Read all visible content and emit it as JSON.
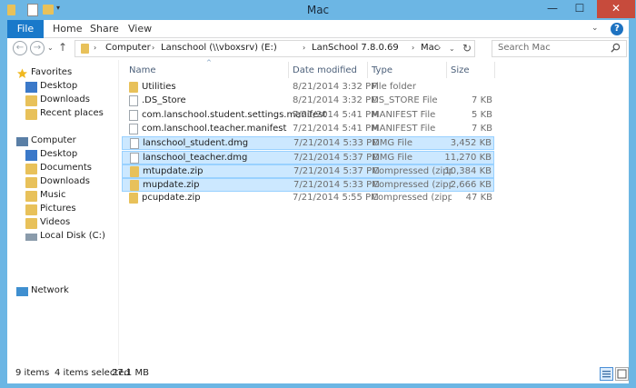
{
  "window": {
    "title": "Mac",
    "minimize": "—",
    "maximize": "☐",
    "close": "✕"
  },
  "ribbon": {
    "tabs": [
      "File",
      "Home",
      "Share",
      "View"
    ],
    "help": "?"
  },
  "nav": {
    "back": "←",
    "forward": "→",
    "recent": "⌄",
    "up": "↑",
    "breadcrumb": [
      "Computer",
      "Lanschool (\\\\vboxsrv) (E:)",
      "LanSchool 7.8.0.69",
      "Mac"
    ],
    "search_placeholder": "Search Mac"
  },
  "sidebar": {
    "favorites": {
      "label": "Favorites",
      "items": [
        "Desktop",
        "Downloads",
        "Recent places"
      ]
    },
    "computer": {
      "label": "Computer",
      "items": [
        "Desktop",
        "Documents",
        "Downloads",
        "Music",
        "Pictures",
        "Videos",
        "Local Disk (C:)"
      ]
    },
    "network": {
      "label": "Network"
    }
  },
  "columns": {
    "name": "Name",
    "date": "Date modified",
    "type": "Type",
    "size": "Size"
  },
  "files": [
    {
      "name": "Utilities",
      "date": "8/21/2014 3:32 PM",
      "type": "File folder",
      "size": "",
      "icon": "folder-icon",
      "selected": false
    },
    {
      "name": ".DS_Store",
      "date": "8/21/2014 3:32 PM",
      "type": "DS_STORE File",
      "size": "7 KB",
      "icon": "file-icon",
      "selected": false
    },
    {
      "name": "com.lanschool.student.settings.manifest",
      "date": "7/21/2014 5:41 PM",
      "type": "MANIFEST File",
      "size": "5 KB",
      "icon": "file-icon",
      "selected": false
    },
    {
      "name": "com.lanschool.teacher.manifest",
      "date": "7/21/2014 5:41 PM",
      "type": "MANIFEST File",
      "size": "7 KB",
      "icon": "file-icon",
      "selected": false
    },
    {
      "name": "lanschool_student.dmg",
      "date": "7/21/2014 5:33 PM",
      "type": "DMG File",
      "size": "3,452 KB",
      "icon": "file-icon",
      "selected": true
    },
    {
      "name": "lanschool_teacher.dmg",
      "date": "7/21/2014 5:37 PM",
      "type": "DMG File",
      "size": "11,270 KB",
      "icon": "file-icon",
      "selected": true
    },
    {
      "name": "mtupdate.zip",
      "date": "7/21/2014 5:37 PM",
      "type": "Compressed (zipp...",
      "size": "10,384 KB",
      "icon": "zip-folder-icon",
      "selected": true
    },
    {
      "name": "mupdate.zip",
      "date": "7/21/2014 5:33 PM",
      "type": "Compressed (zipp...",
      "size": "2,666 KB",
      "icon": "zip-folder-icon",
      "selected": true
    },
    {
      "name": "pcupdate.zip",
      "date": "7/21/2014 5:55 PM",
      "type": "Compressed (zipp...",
      "size": "47 KB",
      "icon": "zip-folder-icon",
      "selected": false
    }
  ],
  "status": {
    "items": "9 items",
    "selected": "4 items selected",
    "size": "27.1 MB"
  },
  "colors": {
    "titlebar": "#6cb6e4",
    "file_tab": "#1979ca",
    "selection": "#cce8ff",
    "close": "#c74b3c"
  }
}
